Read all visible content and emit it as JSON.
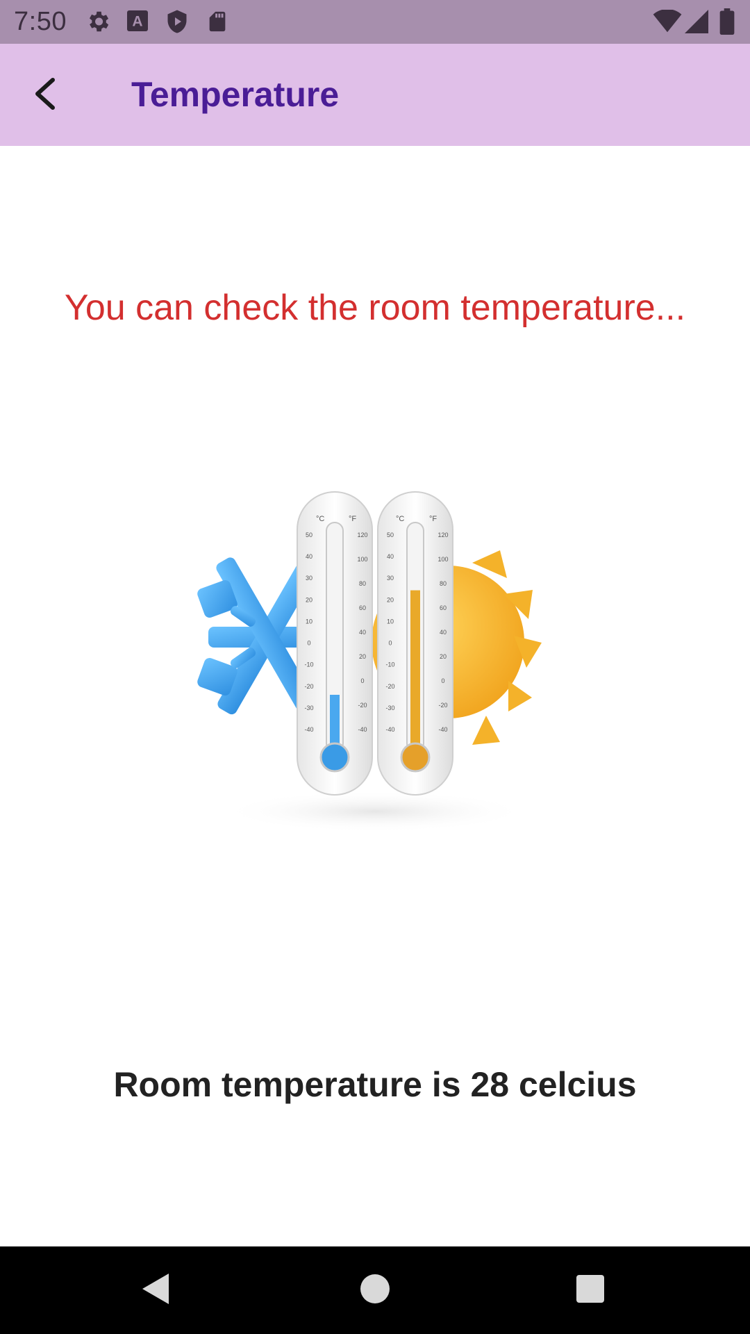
{
  "status_bar": {
    "time": "7:50",
    "left_icons": [
      "settings-icon",
      "font-a-icon",
      "shield-play-icon",
      "sd-card-icon"
    ],
    "right_icons": [
      "wifi-icon",
      "signal-icon",
      "battery-icon"
    ]
  },
  "app_bar": {
    "title": "Temperature",
    "back_icon": "arrow-back-icon",
    "background": "#e0bfe8",
    "title_color": "#4a1d96"
  },
  "main": {
    "prompt": "You can check the room temperature...",
    "prompt_color": "#d32f2f",
    "illustration": "thermometers-snowflake-sun-image",
    "thermometers": {
      "scale_celsius": [
        "50",
        "40",
        "30",
        "20",
        "10",
        "0",
        "-10",
        "-20",
        "-30",
        "-40"
      ],
      "scale_fahrenheit": [
        "120",
        "100",
        "80",
        "60",
        "40",
        "20",
        "0",
        "-20",
        "-40"
      ],
      "unit_c": "°C",
      "unit_f": "°F",
      "cold_level": 0.25,
      "hot_level": 0.72
    },
    "result": "Room temperature is 28 celcius"
  },
  "nav_bar": {
    "buttons": [
      "back-triangle-icon",
      "home-circle-icon",
      "recents-square-icon"
    ]
  }
}
